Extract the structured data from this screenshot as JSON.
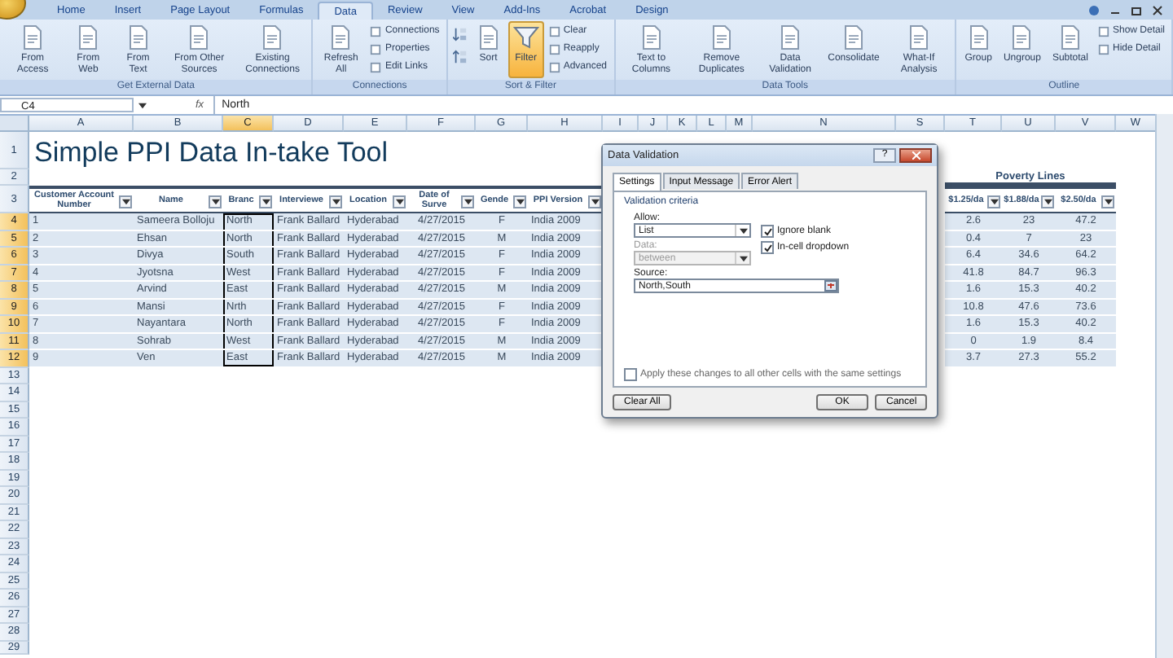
{
  "ribbon_tabs": [
    {
      "label": "Home",
      "selected": false
    },
    {
      "label": "Insert",
      "selected": false
    },
    {
      "label": "Page Layout",
      "selected": false
    },
    {
      "label": "Formulas",
      "selected": false
    },
    {
      "label": "Data",
      "selected": true
    },
    {
      "label": "Review",
      "selected": false
    },
    {
      "label": "View",
      "selected": false
    },
    {
      "label": "Add-Ins",
      "selected": false
    },
    {
      "label": "Acrobat",
      "selected": false
    },
    {
      "label": "Design",
      "selected": false
    }
  ],
  "ribbon_groups": [
    {
      "label": "Get External Data",
      "items": [
        {
          "kind": "large",
          "label": "From Access",
          "on": false
        },
        {
          "kind": "large",
          "label": "From Web",
          "on": false
        },
        {
          "kind": "large",
          "label": "From Text",
          "on": false
        },
        {
          "kind": "large",
          "label": "From Other Sources",
          "on": false
        },
        {
          "kind": "large",
          "label": "Existing Connections",
          "on": false
        }
      ]
    },
    {
      "label": "Connections",
      "items": [
        {
          "kind": "large",
          "label": "Refresh All",
          "on": false
        },
        {
          "kind": "small",
          "label": "Connections",
          "on": false
        },
        {
          "kind": "small",
          "label": "Properties",
          "on": false
        },
        {
          "kind": "small",
          "label": "Edit Links",
          "on": false
        }
      ]
    },
    {
      "label": "Sort & Filter",
      "items": [
        {
          "kind": "sort_ascending",
          "on": false
        },
        {
          "kind": "sort_descending",
          "on": false
        },
        {
          "kind": "large",
          "label": "Sort",
          "on": false
        },
        {
          "kind": "filter",
          "label": "Filter",
          "on": true
        },
        {
          "kind": "small",
          "label": "Clear",
          "on": false
        },
        {
          "kind": "small",
          "label": "Reapply",
          "on": false
        },
        {
          "kind": "small",
          "label": "Advanced",
          "on": false
        }
      ]
    },
    {
      "label": "Data Tools",
      "items": [
        {
          "kind": "large",
          "label": "Text to Columns",
          "on": false
        },
        {
          "kind": "large",
          "label": "Remove Duplicates",
          "on": false
        },
        {
          "kind": "large",
          "label": "Data Validation",
          "on": false
        },
        {
          "kind": "large",
          "label": "Consolidate",
          "on": false
        },
        {
          "kind": "large",
          "label": "What-If Analysis",
          "on": false
        }
      ]
    },
    {
      "label": "Outline",
      "items": [
        {
          "kind": "large",
          "label": "Group",
          "on": false
        },
        {
          "kind": "large",
          "label": "Ungroup",
          "on": false
        },
        {
          "kind": "large",
          "label": "Subtotal",
          "on": false
        },
        {
          "kind": "small",
          "label": "Show Detail",
          "on": false
        },
        {
          "kind": "small",
          "label": "Hide Detail",
          "on": false
        }
      ]
    }
  ],
  "formula_bar": {
    "name_box": "C4",
    "function_label": "fx",
    "value": "North"
  },
  "sheet": {
    "columns": [
      {
        "label": "A",
        "selected": false
      },
      {
        "label": "B",
        "selected": false
      },
      {
        "label": "C",
        "selected": true
      },
      {
        "label": "D",
        "selected": false
      },
      {
        "label": "E",
        "selected": false
      },
      {
        "label": "F",
        "selected": false
      },
      {
        "label": "G",
        "selected": false
      },
      {
        "label": "H",
        "selected": false
      },
      {
        "label": "I",
        "selected": false
      },
      {
        "label": "J",
        "selected": false
      },
      {
        "label": "K",
        "selected": false
      },
      {
        "label": "L",
        "selected": false
      },
      {
        "label": "M",
        "selected": false
      },
      {
        "label": "N",
        "selected": false
      },
      {
        "label": "S",
        "selected": false
      },
      {
        "label": "T",
        "selected": false
      },
      {
        "label": "U",
        "selected": false
      },
      {
        "label": "V",
        "selected": false
      },
      {
        "label": "W",
        "selected": false
      }
    ],
    "rows": [
      {
        "number": "1",
        "selected": false
      },
      {
        "number": "2",
        "selected": false
      },
      {
        "number": "3",
        "selected": false
      },
      {
        "number": "4",
        "selected": true
      },
      {
        "number": "5",
        "selected": true
      },
      {
        "number": "6",
        "selected": true
      },
      {
        "number": "7",
        "selected": true
      },
      {
        "number": "8",
        "selected": true
      },
      {
        "number": "9",
        "selected": true
      },
      {
        "number": "10",
        "selected": true
      },
      {
        "number": "11",
        "selected": true
      },
      {
        "number": "12",
        "selected": true
      },
      {
        "number": "13",
        "selected": false
      },
      {
        "number": "14",
        "selected": false
      },
      {
        "number": "15",
        "selected": false
      },
      {
        "number": "16",
        "selected": false
      },
      {
        "number": "17",
        "selected": false
      },
      {
        "number": "18",
        "selected": false
      },
      {
        "number": "19",
        "selected": false
      },
      {
        "number": "20",
        "selected": false
      },
      {
        "number": "21",
        "selected": false
      },
      {
        "number": "22",
        "selected": false
      },
      {
        "number": "23",
        "selected": false
      },
      {
        "number": "24",
        "selected": false
      },
      {
        "number": "25",
        "selected": false
      },
      {
        "number": "26",
        "selected": false
      },
      {
        "number": "27",
        "selected": false
      },
      {
        "number": "28",
        "selected": false
      },
      {
        "number": "29",
        "selected": false
      }
    ],
    "title": "Simple PPI Data In-take Tool",
    "group_header": "Poverty Lines",
    "headers": [
      "Customer Account Number",
      "Name",
      "Branc",
      "Interviewe",
      "Location",
      "Date of Surve",
      "Gende",
      "PPI Version",
      "$1.25/da",
      "$1.88/da",
      "$2.50/da"
    ],
    "records": [
      [
        "1",
        "Sameera Bolloju",
        "North",
        "Frank Ballard",
        "Hyderabad",
        "4/27/2015",
        "F",
        "India 2009",
        "2.6",
        "23",
        "47.2"
      ],
      [
        "2",
        "Ehsan",
        "North",
        "Frank Ballard",
        "Hyderabad",
        "4/27/2015",
        "M",
        "India 2009",
        "0.4",
        "7",
        "23"
      ],
      [
        "3",
        "Divya",
        "South",
        "Frank Ballard",
        "Hyderabad",
        "4/27/2015",
        "F",
        "India 2009",
        "6.4",
        "34.6",
        "64.2"
      ],
      [
        "4",
        "Jyotsna",
        "West",
        "Frank Ballard",
        "Hyderabad",
        "4/27/2015",
        "F",
        "India 2009",
        "41.8",
        "84.7",
        "96.3"
      ],
      [
        "5",
        "Arvind",
        "East",
        "Frank Ballard",
        "Hyderabad",
        "4/27/2015",
        "M",
        "India 2009",
        "1.6",
        "15.3",
        "40.2"
      ],
      [
        "6",
        "Mansi",
        "Nrth",
        "Frank Ballard",
        "Hyderabad",
        "4/27/2015",
        "F",
        "India 2009",
        "10.8",
        "47.6",
        "73.6"
      ],
      [
        "7",
        "Nayantara",
        "North",
        "Frank Ballard",
        "Hyderabad",
        "4/27/2015",
        "F",
        "India 2009",
        "1.6",
        "15.3",
        "40.2"
      ],
      [
        "8",
        "Sohrab",
        "West",
        "Frank Ballard",
        "Hyderabad",
        "4/27/2015",
        "M",
        "India 2009",
        "0",
        "1.9",
        "8.4"
      ],
      [
        "9",
        "Ven",
        "East",
        "Frank Ballard",
        "Hyderabad",
        "4/27/2015",
        "M",
        "India 2009",
        "3.7",
        "27.3",
        "55.2"
      ]
    ]
  },
  "dialog": {
    "title": "Data Validation",
    "help_button": "?",
    "tabs": [
      {
        "label": "Settings",
        "selected": true
      },
      {
        "label": "Input Message",
        "selected": false
      },
      {
        "label": "Error Alert",
        "selected": false
      }
    ],
    "section": "Validation criteria",
    "allow_label": "Allow:",
    "allow_value": "List",
    "data_label": "Data:",
    "data_value": "between",
    "data_disabled": true,
    "checkboxes": [
      {
        "label": "Ignore blank",
        "checked": true
      },
      {
        "label": "In-cell dropdown",
        "checked": true
      }
    ],
    "source_label": "Source:",
    "source_value": "North,South",
    "apply_all": {
      "label": "Apply these changes to all other cells with the same settings",
      "checked": false
    },
    "buttons": [
      "Clear All",
      "OK",
      "Cancel"
    ]
  }
}
